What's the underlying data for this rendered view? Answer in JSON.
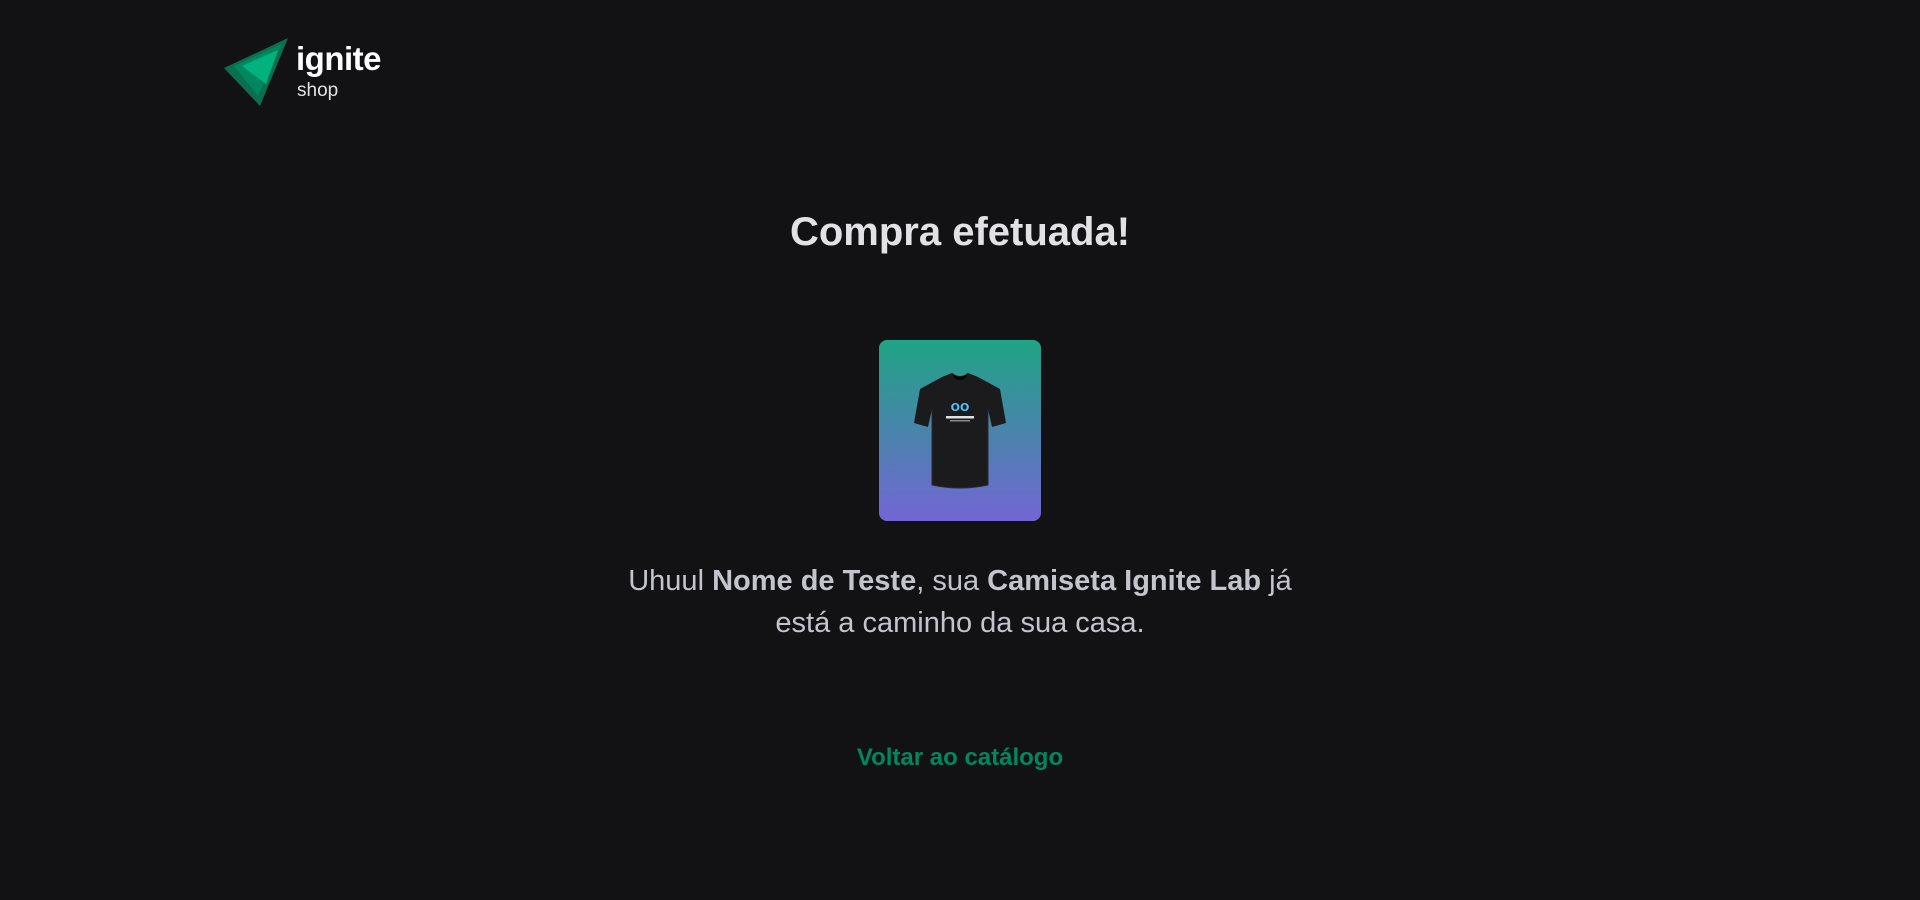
{
  "header": {
    "logo_word": "ignite",
    "logo_sub": "shop",
    "logo_colors": [
      "#00875f",
      "#00b37e"
    ]
  },
  "main": {
    "title": "Compra efetuada!",
    "product_image_icon": "tshirt-image",
    "message": {
      "prefix": "Uhuul ",
      "customer_name": "Nome de Teste",
      "middle": ", sua ",
      "product_name": "Camiseta Ignite Lab",
      "suffix": " já está a caminho da sua casa."
    },
    "back_link_label": "Voltar ao catálogo",
    "accent_color": "#00875f"
  }
}
